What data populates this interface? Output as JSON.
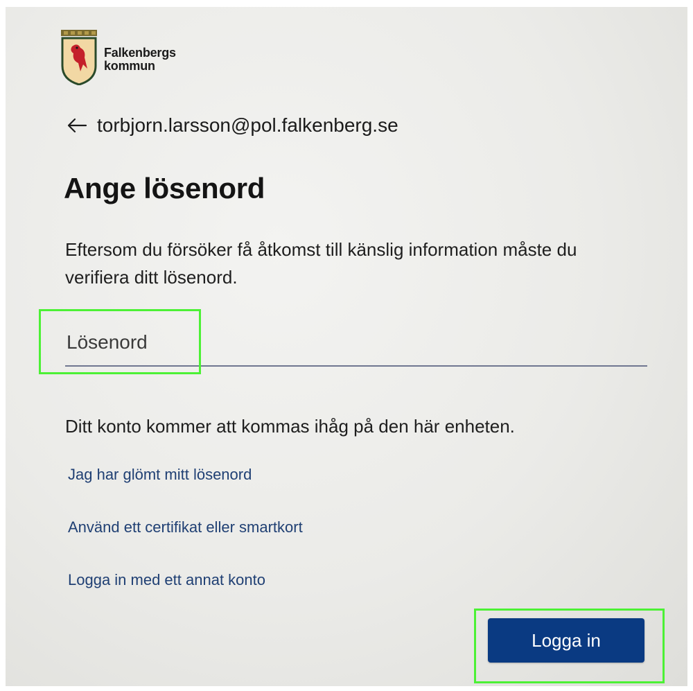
{
  "brand": {
    "name_line1": "Falkenbergs",
    "name_line2": "kommun",
    "crest_icon": "coat-of-arms-bird-icon",
    "crest_colors": {
      "shield": "#f2d8a4",
      "bird": "#c4202a",
      "crown": "#8a7a3a"
    }
  },
  "identity": {
    "back_icon": "left-arrow-icon",
    "email": "torbjorn.larsson@pol.falkenberg.se"
  },
  "title": "Ange lösenord",
  "description": "Eftersom du försöker få åtkomst till känslig information måste du verifiera ditt lösenord.",
  "password_field": {
    "placeholder": "Lösenord",
    "value": ""
  },
  "notice": "Ditt konto kommer att kommas ihåg på den här enheten.",
  "links": {
    "forgot_password": "Jag har glömt mitt lösenord",
    "certificate": "Använd ett certifikat eller smartkort",
    "other_account": "Logga in med ett annat konto"
  },
  "signin_button": {
    "label": "Logga in"
  },
  "colors": {
    "primary_button": "#0a3a82",
    "link": "#1f3f73",
    "highlight": "#4cf135",
    "input_underline": "#6f7690"
  }
}
